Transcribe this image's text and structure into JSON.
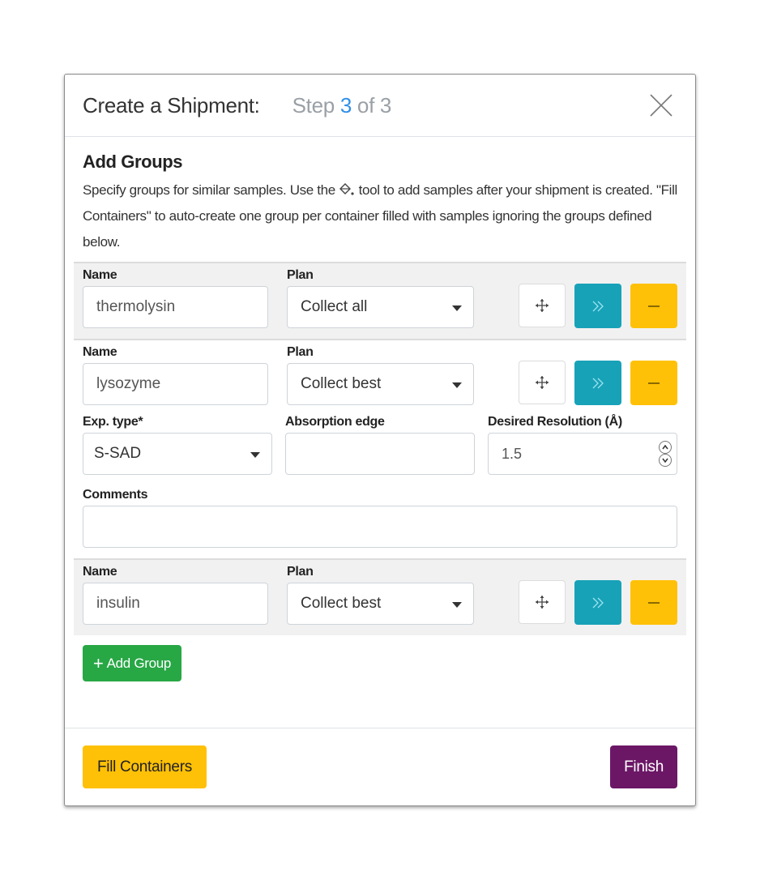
{
  "header": {
    "title": "Create a Shipment:",
    "step_prefix": "Step ",
    "step_current": "3",
    "step_suffix": " of 3",
    "close_icon": "close-icon"
  },
  "section": {
    "title": "Add Groups",
    "desc_part1": "Specify groups for similar samples. Use the ",
    "desc_icon": "fill-bucket-icon",
    "desc_part2": " tool to add samples after your shipment is created. \"Fill Containers\" to auto-create one group per container filled with samples ignoring the groups defined below."
  },
  "labels": {
    "name": "Name",
    "plan": "Plan",
    "exp_type": "Exp. type*",
    "absorption_edge": "Absorption edge",
    "desired_resolution": "Desired Resolution (Å)",
    "comments": "Comments"
  },
  "groups": [
    {
      "name": "thermolysin",
      "plan": "Collect all",
      "expanded": false
    },
    {
      "name": "lysozyme",
      "plan": "Collect best",
      "expanded": true,
      "exp_type": "S-SAD",
      "absorption_edge": "",
      "desired_resolution": "1.5",
      "comments": ""
    },
    {
      "name": "insulin",
      "plan": "Collect best",
      "expanded": false
    }
  ],
  "icons": {
    "move": "move-icon",
    "expand": "chevron-double-right-icon",
    "remove": "minus-icon"
  },
  "buttons": {
    "add_group_icon": "+",
    "add_group": "Add Group",
    "fill_containers": "Fill Containers",
    "finish": "Finish"
  },
  "colors": {
    "accent_blue": "#2f8fe8",
    "info": "#17a2b8",
    "warning": "#ffc107",
    "success": "#28a745",
    "finish": "#6b1766"
  }
}
